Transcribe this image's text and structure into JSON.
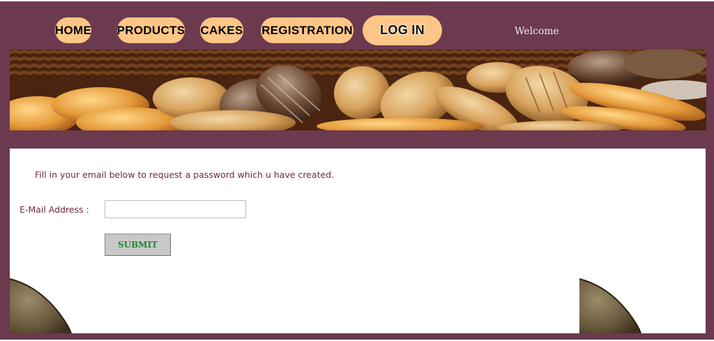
{
  "nav": {
    "items": [
      {
        "label": "HOME"
      },
      {
        "label": "PRODUCTS"
      },
      {
        "label": "CAKES"
      },
      {
        "label": "REGISTRATION"
      },
      {
        "label": "LOG IN"
      }
    ],
    "welcome": "Welcome"
  },
  "banner": {
    "image": "bread-assortment-banner"
  },
  "form": {
    "intro": "Fill in your email below to request a password which u have created.",
    "email_label": "E-Mail Address :",
    "email_value": "",
    "submit_label": "SUBMIT"
  },
  "colors": {
    "background": "#6b3a4f",
    "nav_button": "#fdc686",
    "text": "#6b2a3c",
    "submit_text": "#1c8c2c"
  }
}
